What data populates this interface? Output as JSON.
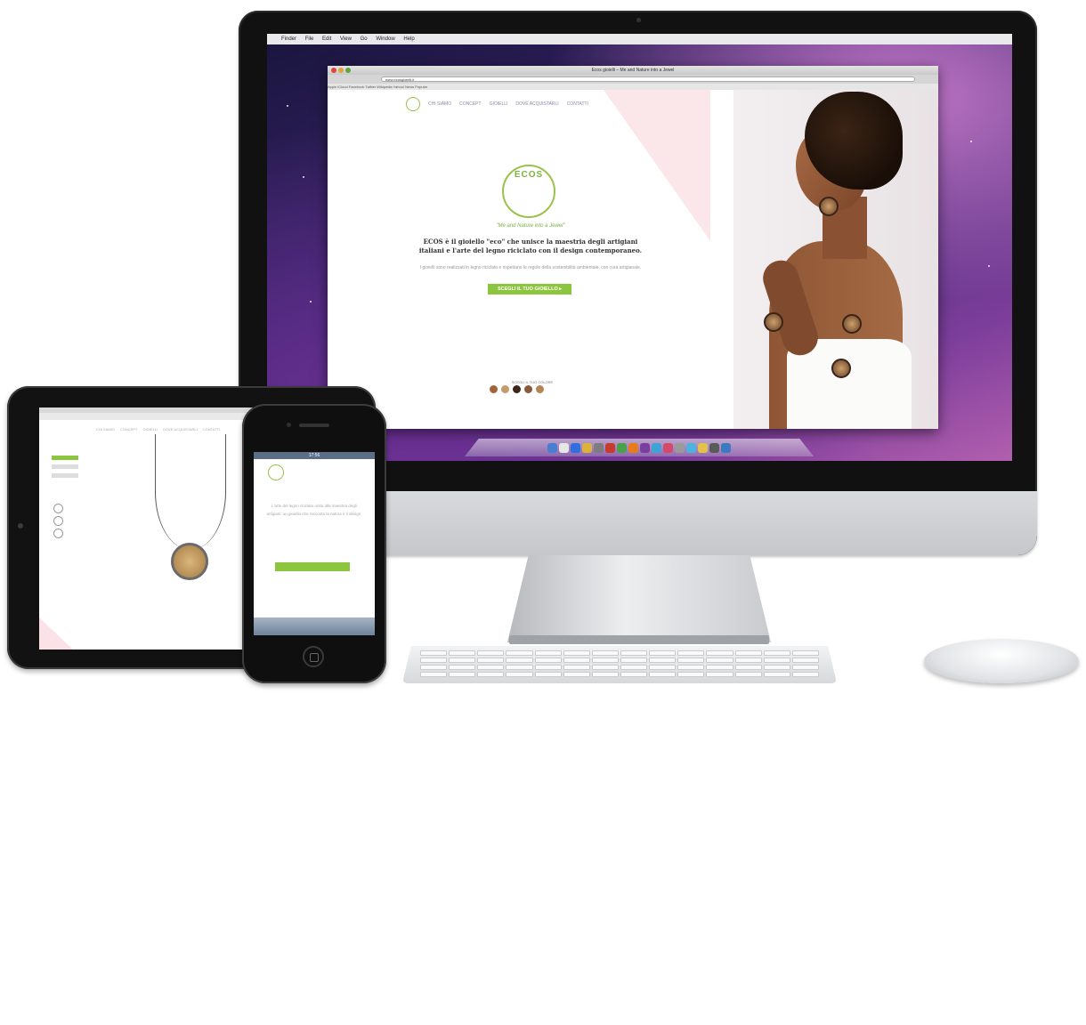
{
  "imac": {
    "menubar_items": [
      "Finder",
      "File",
      "Edit",
      "View",
      "Go",
      "Window",
      "Help"
    ],
    "browser": {
      "window_title": "Ecos gioielli – Me and Nature into a Jewel",
      "url": "www.ecosgioielli.it",
      "bookmarks": "Apple  iCloud  Facebook  Twitter  Wikipedia  Yahoo!  News  Popular"
    },
    "site": {
      "nav_logo_icon": "leaf-icon",
      "nav": [
        "CHI SIAMO",
        "CONCEPT",
        "GIOIELLI",
        "DOVE ACQUISTARLI",
        "CONTATTI"
      ],
      "logo_text": "ECOS",
      "tagline": "\"Me and Nature into a Jewel\"",
      "headline": "ECOS è il gioiello \"eco\" che unisce la maestria degli artigiani italiani e l'arte del legno riciclato con il design contemporaneo.",
      "subtext": "I gioielli sono realizzati in legno riciclato e rispettano le regole della sostenibilità ambientale, con cura artigianale.",
      "cta_label": "SCEGLI IL TUO GIOIELLO ▸",
      "colors_label": "SCEGLI IL TUO COLORE",
      "swatch_colors": [
        "#a0653d",
        "#c59a6d",
        "#3c2519",
        "#8a5a3a",
        "#b58553"
      ]
    },
    "dock_colors": [
      "#4a7fd0",
      "#e6e6e6",
      "#2f6fe0",
      "#dcb23a",
      "#7d7d7d",
      "#c63b2c",
      "#47a24a",
      "#e87b1a",
      "#7a3fa0",
      "#3ca5d8",
      "#d44a6a",
      "#9a9a9a",
      "#4ab3e0",
      "#e2c24a",
      "#5a5a5a",
      "#3a7ac0"
    ]
  },
  "ipad": {
    "nav": [
      "CHI SIAMO",
      "CONCEPT",
      "GIOIELLI",
      "DOVE ACQUISTARLI",
      "CONTATTI"
    ]
  },
  "iphone": {
    "status_time": "17:56",
    "menu_icon": "menu-icon",
    "text": "L'arte del legno riciclato unita alla maestria degli artigiani: un gioiello che racconta la natura e il design."
  }
}
